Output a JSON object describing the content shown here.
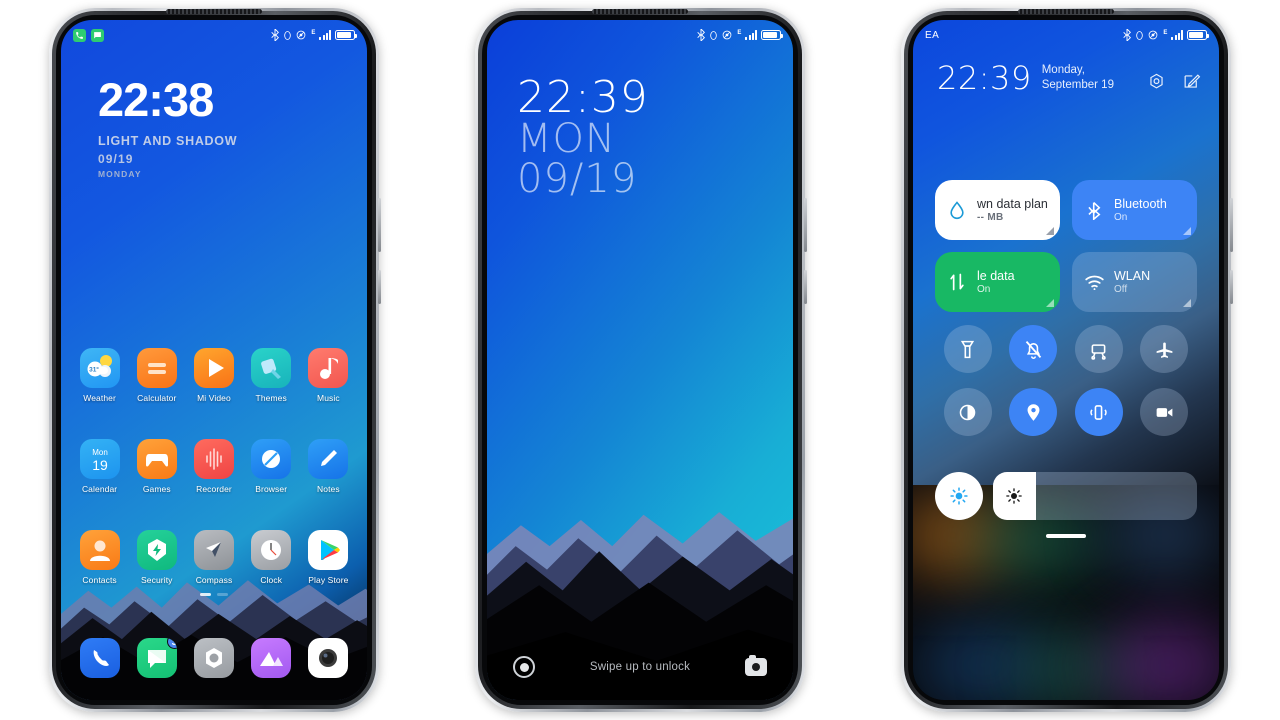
{
  "phone1": {
    "name": "home-screen",
    "statusbar": {
      "notifications": [
        "phone-icon",
        "message-icon"
      ],
      "icons": [
        "bluetooth-icon",
        "alarm-icon",
        "dnd-icon",
        "network-type-E",
        "signal-icon",
        "battery-icon"
      ],
      "network_type": "E"
    },
    "clock": {
      "time": "22:38",
      "theme_name": "LIGHT AND SHADOW",
      "date": "09/19",
      "weekday": "MONDAY"
    },
    "apps_row1": [
      {
        "label": "Weather",
        "icon": "weather-icon",
        "temp": "31°"
      },
      {
        "label": "Calculator",
        "icon": "calculator-icon"
      },
      {
        "label": "Mi Video",
        "icon": "video-play-icon"
      },
      {
        "label": "Themes",
        "icon": "themes-brush-icon"
      },
      {
        "label": "Music",
        "icon": "music-note-icon"
      }
    ],
    "apps_row2": [
      {
        "label": "Calendar",
        "icon": "calendar-icon",
        "day_name": "Mon",
        "day_number": "19"
      },
      {
        "label": "Games",
        "icon": "gamepad-icon"
      },
      {
        "label": "Recorder",
        "icon": "recorder-waveform-icon"
      },
      {
        "label": "Browser",
        "icon": "browser-compass-icon"
      },
      {
        "label": "Notes",
        "icon": "pencil-icon"
      }
    ],
    "apps_row3": [
      {
        "label": "Contacts",
        "icon": "person-icon"
      },
      {
        "label": "Security",
        "icon": "shield-bolt-icon"
      },
      {
        "label": "Compass",
        "icon": "compass-needle-icon"
      },
      {
        "label": "Clock",
        "icon": "analog-clock-icon"
      },
      {
        "label": "Play Store",
        "icon": "play-store-icon"
      }
    ],
    "dock": [
      {
        "label": "Phone",
        "icon": "phone-handset-icon",
        "badge": ""
      },
      {
        "label": "Messaging",
        "icon": "message-bubble-icon",
        "badge": "3"
      },
      {
        "label": "Settings",
        "icon": "settings-gear-icon",
        "badge": ""
      },
      {
        "label": "Gallery",
        "icon": "gallery-mountain-icon",
        "badge": ""
      },
      {
        "label": "Camera",
        "icon": "camera-lens-icon",
        "badge": ""
      }
    ],
    "page_indicator": {
      "pages": 2,
      "active": 1
    }
  },
  "phone2": {
    "name": "lock-screen",
    "statusbar": {
      "icons": [
        "bluetooth-icon",
        "alarm-icon",
        "dnd-icon",
        "network-type-E",
        "signal-icon",
        "battery-icon"
      ],
      "network_type": "E"
    },
    "clock": {
      "time": "22:39",
      "weekday": "MON",
      "date": "09/19"
    },
    "bottom": {
      "left_icon": "fingerprint-unlock-icon",
      "hint": "Swipe up to unlock",
      "right_icon": "camera-icon"
    }
  },
  "phone3": {
    "name": "notification-shade",
    "statusbar": {
      "carrier": "EA",
      "icons": [
        "bluetooth-icon",
        "alarm-icon",
        "dnd-icon",
        "network-type-E",
        "signal-icon",
        "battery-icon"
      ],
      "network_type": "E"
    },
    "header": {
      "time": "22:39",
      "date": "Monday, September 19",
      "actions": [
        "settings-gear-icon",
        "edit-icon"
      ]
    },
    "tiles": [
      {
        "title": "wn data plan",
        "sub": "-- MB",
        "icon": "data-drop-icon",
        "state": "light"
      },
      {
        "title": "Bluetooth",
        "sub": "On",
        "icon": "bluetooth-icon",
        "state": "blue"
      },
      {
        "title": "le data",
        "sub": "On",
        "icon": "mobile-data-arrows-icon",
        "state": "green"
      },
      {
        "title": "WLAN",
        "sub": "Off",
        "icon": "wifi-icon",
        "state": "dim"
      }
    ],
    "toggles": [
      {
        "name": "flashlight-icon",
        "on": false
      },
      {
        "name": "silent-bell-off-icon",
        "on": true
      },
      {
        "name": "screenshot-icon",
        "on": false
      },
      {
        "name": "airplane-mode-icon",
        "on": false
      },
      {
        "name": "dark-mode-icon",
        "on": false
      },
      {
        "name": "location-pin-icon",
        "on": true
      },
      {
        "name": "vibrate-icon",
        "on": true
      },
      {
        "name": "screen-recorder-icon",
        "on": false
      }
    ],
    "brightness": {
      "auto_icon": "auto-brightness-icon",
      "slider_icon": "brightness-sun-icon",
      "level": "21%"
    }
  }
}
